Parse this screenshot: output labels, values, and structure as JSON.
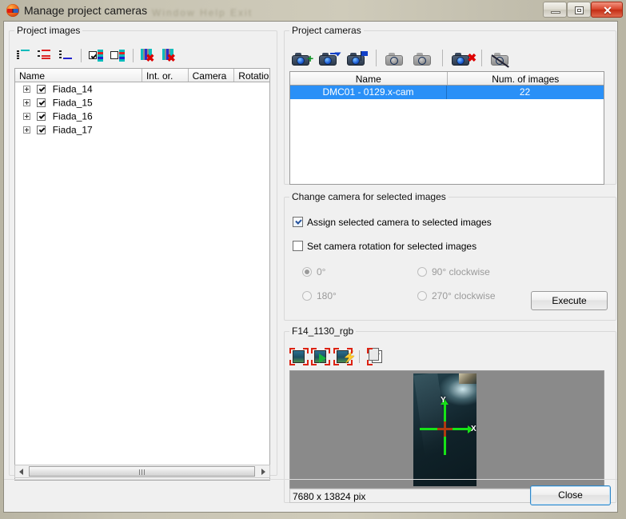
{
  "window": {
    "title": "Manage project cameras",
    "ghost_menu_text": "Window   Help   Exit",
    "minimize_label": "",
    "maximize_label": "",
    "close_label": "✕"
  },
  "project_images": {
    "legend": "Project images",
    "toolbar": [
      {
        "name": "select-all-rows-icon",
        "tip": "Select all"
      },
      {
        "name": "expand-rows-icon",
        "tip": "Expand"
      },
      {
        "name": "collapse-rows-icon",
        "tip": "Collapse"
      },
      {
        "name": "check-all-icon",
        "tip": "Check all"
      },
      {
        "name": "uncheck-all-icon",
        "tip": "Uncheck all"
      },
      {
        "name": "remove-selected-icon",
        "tip": "Remove selected"
      },
      {
        "name": "remove-all-icon",
        "tip": "Remove all"
      }
    ],
    "columns": [
      "Name",
      "Int. or.",
      "Camera",
      "Rotation"
    ],
    "rows": [
      {
        "name": "Fiada_14",
        "checked": true,
        "int_or": "",
        "camera": "",
        "rotation": ""
      },
      {
        "name": "Fiada_15",
        "checked": true,
        "int_or": "",
        "camera": "",
        "rotation": ""
      },
      {
        "name": "Fiada_16",
        "checked": true,
        "int_or": "",
        "camera": "",
        "rotation": ""
      },
      {
        "name": "Fiada_17",
        "checked": true,
        "int_or": "",
        "camera": "",
        "rotation": ""
      }
    ]
  },
  "project_cameras": {
    "legend": "Project cameras",
    "toolbar": [
      {
        "name": "add-camera-icon"
      },
      {
        "name": "import-camera-icon"
      },
      {
        "name": "edit-camera-icon"
      },
      {
        "name": "copy-camera-icon"
      },
      {
        "name": "duplicate-camera-icon"
      },
      {
        "name": "delete-camera-icon"
      },
      {
        "name": "disable-camera-icon"
      }
    ],
    "columns": [
      "Name",
      "Num. of images"
    ],
    "rows": [
      {
        "name": "DMC01 - 0129.x-cam",
        "num_images": "22",
        "selected": true
      }
    ]
  },
  "change_camera": {
    "legend": "Change camera for selected images",
    "assign_checkbox": {
      "label": "Assign selected camera to selected images",
      "checked": true
    },
    "rotation_checkbox": {
      "label": "Set camera rotation for selected images",
      "checked": false
    },
    "rotation_options": [
      {
        "label": "0°",
        "selected": true
      },
      {
        "label": "90° clockwise",
        "selected": false
      },
      {
        "label": "180°",
        "selected": false
      },
      {
        "label": "270° clockwise",
        "selected": false
      }
    ],
    "execute_label": "Execute"
  },
  "preview": {
    "legend": "F14_1130_rgb",
    "toolbar": [
      {
        "name": "show-image-icon"
      },
      {
        "name": "play-image-icon"
      },
      {
        "name": "quick-process-icon"
      },
      {
        "name": "copy-properties-icon"
      }
    ],
    "axis_x_label": "X",
    "axis_y_label": "Y",
    "status": "7680 x 13824 pix"
  },
  "footer": {
    "close_label": "Close"
  },
  "colors": {
    "selection_blue": "#2a90f7",
    "axis_green": "#17e317",
    "axis_red": "#b03a10",
    "close_red": "#d9452b"
  }
}
